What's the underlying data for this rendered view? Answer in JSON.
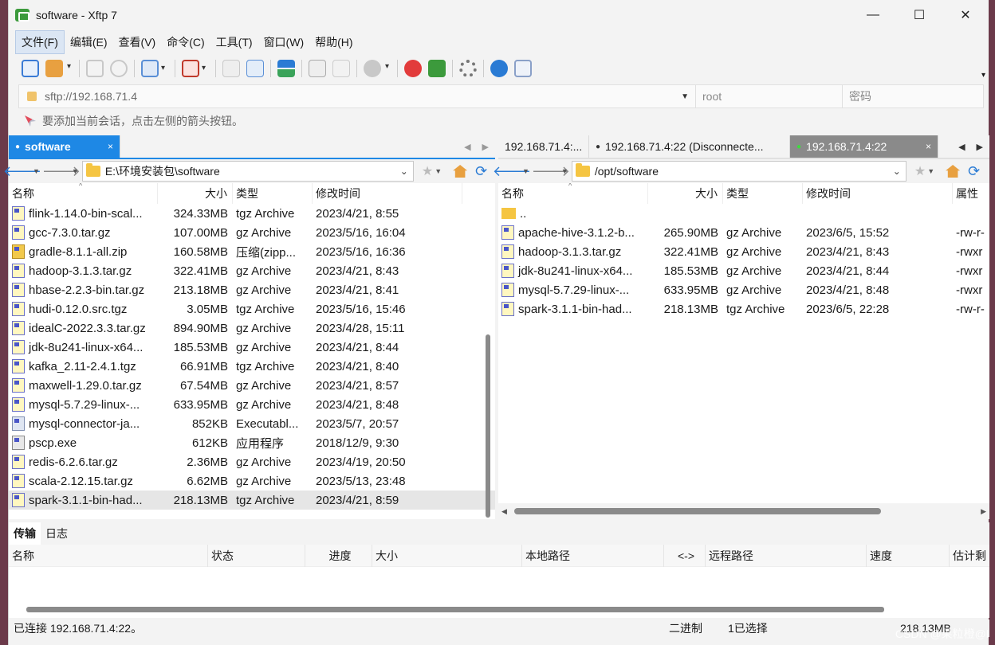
{
  "window": {
    "title": "software - Xftp 7",
    "minimize": "—",
    "maximize": "☐",
    "close": "✕"
  },
  "menu": [
    "文件(F)",
    "编辑(E)",
    "查看(V)",
    "命令(C)",
    "工具(T)",
    "窗口(W)",
    "帮助(H)"
  ],
  "address": {
    "url": "sftp://192.168.71.4",
    "user_placeholder": "root",
    "password_placeholder": "密码"
  },
  "hint": "要添加当前会话，点击左侧的箭头按钮。",
  "left": {
    "tab_label": "software",
    "tab_close": "×",
    "path": "E:\\环境安装包\\software",
    "columns": [
      "名称",
      "大小",
      "类型",
      "修改时间"
    ],
    "files": [
      {
        "name": "flink-1.14.0-bin-scal...",
        "size": "324.33MB",
        "type": "tgz Archive",
        "mtime": "2023/4/21, 8:55",
        "icon": "archive"
      },
      {
        "name": "gcc-7.3.0.tar.gz",
        "size": "107.00MB",
        "type": "gz Archive",
        "mtime": "2023/5/16, 16:04",
        "icon": "archive"
      },
      {
        "name": "gradle-8.1.1-all.zip",
        "size": "160.58MB",
        "type": "压缩(zipp...",
        "mtime": "2023/5/16, 16:36",
        "icon": "zip"
      },
      {
        "name": "hadoop-3.1.3.tar.gz",
        "size": "322.41MB",
        "type": "gz Archive",
        "mtime": "2023/4/21, 8:43",
        "icon": "archive"
      },
      {
        "name": "hbase-2.2.3-bin.tar.gz",
        "size": "213.18MB",
        "type": "gz Archive",
        "mtime": "2023/4/21, 8:41",
        "icon": "archive"
      },
      {
        "name": "hudi-0.12.0.src.tgz",
        "size": "3.05MB",
        "type": "tgz Archive",
        "mtime": "2023/5/16, 15:46",
        "icon": "archive"
      },
      {
        "name": "idealC-2022.3.3.tar.gz",
        "size": "894.90MB",
        "type": "gz Archive",
        "mtime": "2023/4/28, 15:11",
        "icon": "archive"
      },
      {
        "name": "jdk-8u241-linux-x64...",
        "size": "185.53MB",
        "type": "gz Archive",
        "mtime": "2023/4/21, 8:44",
        "icon": "archive"
      },
      {
        "name": "kafka_2.11-2.4.1.tgz",
        "size": "66.91MB",
        "type": "tgz Archive",
        "mtime": "2023/4/21, 8:40",
        "icon": "archive"
      },
      {
        "name": "maxwell-1.29.0.tar.gz",
        "size": "67.54MB",
        "type": "gz Archive",
        "mtime": "2023/4/21, 8:57",
        "icon": "archive"
      },
      {
        "name": "mysql-5.7.29-linux-...",
        "size": "633.95MB",
        "type": "gz Archive",
        "mtime": "2023/4/21, 8:48",
        "icon": "archive"
      },
      {
        "name": "mysql-connector-ja...",
        "size": "852KB",
        "type": "Executabl...",
        "mtime": "2023/5/7, 20:57",
        "icon": "exe"
      },
      {
        "name": "pscp.exe",
        "size": "612KB",
        "type": "应用程序",
        "mtime": "2018/12/9, 9:30",
        "icon": "app"
      },
      {
        "name": "redis-6.2.6.tar.gz",
        "size": "2.36MB",
        "type": "gz Archive",
        "mtime": "2023/4/19, 20:50",
        "icon": "archive"
      },
      {
        "name": "scala-2.12.15.tar.gz",
        "size": "6.62MB",
        "type": "gz Archive",
        "mtime": "2023/5/13, 23:48",
        "icon": "archive"
      },
      {
        "name": "spark-3.1.1-bin-had...",
        "size": "218.13MB",
        "type": "tgz Archive",
        "mtime": "2023/4/21, 8:59",
        "icon": "archive",
        "selected": true
      }
    ]
  },
  "right": {
    "tabs": [
      {
        "label": "192.168.71.4:...",
        "prefix": ""
      },
      {
        "label": "192.168.71.4:22 (Disconnecte...",
        "prefix": "●"
      },
      {
        "label": "192.168.71.4:22",
        "prefix": "●",
        "close": "×"
      }
    ],
    "path": "/opt/software",
    "columns": [
      "名称",
      "大小",
      "类型",
      "修改时间",
      "属性"
    ],
    "files": [
      {
        "name": "..",
        "size": "",
        "type": "",
        "mtime": "",
        "attr": "",
        "icon": "dir"
      },
      {
        "name": "apache-hive-3.1.2-b...",
        "size": "265.90MB",
        "type": "gz Archive",
        "mtime": "2023/6/5, 15:52",
        "attr": "-rw-r-",
        "icon": "archive"
      },
      {
        "name": "hadoop-3.1.3.tar.gz",
        "size": "322.41MB",
        "type": "gz Archive",
        "mtime": "2023/4/21, 8:43",
        "attr": "-rwxr",
        "icon": "archive"
      },
      {
        "name": "jdk-8u241-linux-x64...",
        "size": "185.53MB",
        "type": "gz Archive",
        "mtime": "2023/4/21, 8:44",
        "attr": "-rwxr",
        "icon": "archive"
      },
      {
        "name": "mysql-5.7.29-linux-...",
        "size": "633.95MB",
        "type": "gz Archive",
        "mtime": "2023/4/21, 8:48",
        "attr": "-rwxr",
        "icon": "archive"
      },
      {
        "name": "spark-3.1.1-bin-had...",
        "size": "218.13MB",
        "type": "tgz Archive",
        "mtime": "2023/6/5, 22:28",
        "attr": "-rw-r-",
        "icon": "archive"
      }
    ]
  },
  "transfer": {
    "tabs": [
      "传输",
      "日志"
    ],
    "columns": [
      "名称",
      "状态",
      "进度",
      "大小",
      "本地路径",
      "<->",
      "远程路径",
      "速度",
      "估计剩"
    ]
  },
  "status": {
    "connection": "已连接 192.168.71.4:22。",
    "mode": "二进制",
    "selected": "1已选择",
    "size": "218.13MB"
  },
  "watermark": "CSDN @果粒橙@l"
}
